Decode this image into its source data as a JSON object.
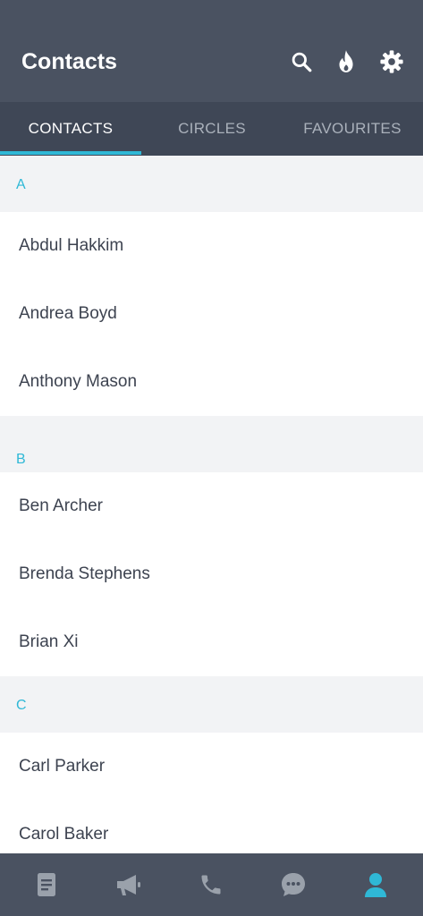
{
  "app": {
    "title": "Contacts"
  },
  "toolbar": {
    "search_icon": "search-icon",
    "flame_icon": "flame-icon",
    "settings_icon": "gear-icon"
  },
  "tabs": [
    {
      "label": "CONTACTS",
      "active": true
    },
    {
      "label": "CIRCLES",
      "active": false
    },
    {
      "label": "FAVOURITES",
      "active": false
    }
  ],
  "sections": [
    {
      "letter": "A",
      "contacts": [
        "Abdul Hakkim",
        "Andrea Boyd",
        "Anthony Mason"
      ]
    },
    {
      "letter": "B",
      "contacts": [
        "Ben Archer",
        "Brenda Stephens",
        "Brian Xi"
      ]
    },
    {
      "letter": "C",
      "contacts": [
        "Carl Parker",
        "Carol Baker"
      ]
    }
  ],
  "bottom_nav": [
    {
      "icon": "document-icon",
      "active": false
    },
    {
      "icon": "megaphone-icon",
      "active": false
    },
    {
      "icon": "phone-icon",
      "active": false
    },
    {
      "icon": "chat-icon",
      "active": false
    },
    {
      "icon": "person-icon",
      "active": true
    }
  ],
  "colors": {
    "accent": "#2fb8d6",
    "appbar": "#4a5261",
    "tabbar": "#3f4756",
    "nav_inactive": "#9aa1ab"
  }
}
